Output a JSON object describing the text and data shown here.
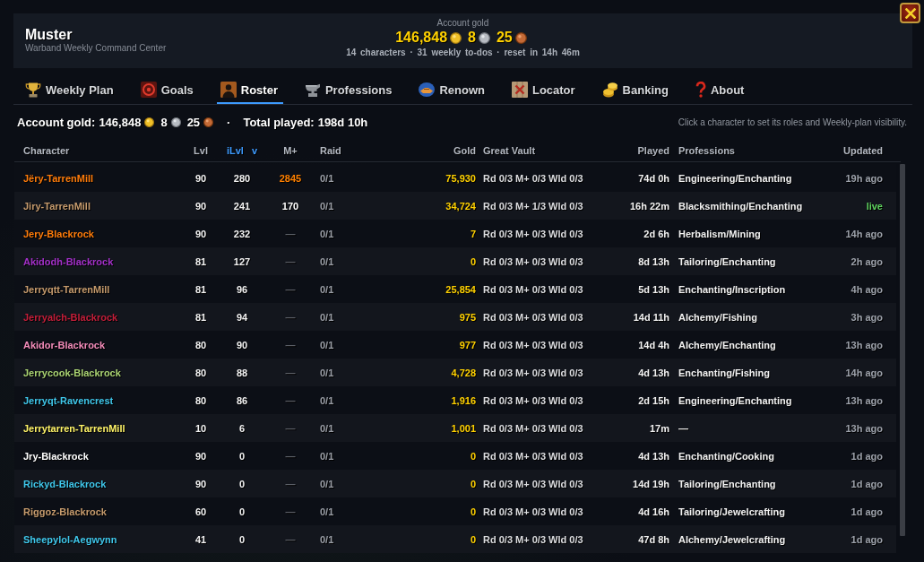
{
  "window": {
    "title": "Muster",
    "subtitle": "Warband Weekly Command Center"
  },
  "account_gold": {
    "label": "Account gold",
    "amounts": [
      {
        "kind": "gold",
        "value": "146,848"
      },
      {
        "kind": "silver",
        "value": "8"
      },
      {
        "kind": "copper",
        "value": "25"
      }
    ],
    "stats": "14 characters · 31 weekly to-dos · reset in 14h 46m"
  },
  "tabs": [
    {
      "label": "Weekly Plan",
      "selected": false
    },
    {
      "label": "Goals",
      "selected": false
    },
    {
      "label": "Roster",
      "selected": true
    },
    {
      "label": "Professions",
      "selected": false
    },
    {
      "label": "Renown",
      "selected": false
    },
    {
      "label": "Locator",
      "selected": false
    },
    {
      "label": "Banking",
      "selected": false
    },
    {
      "label": "About",
      "selected": false
    }
  ],
  "summary": {
    "gold_label": "Account gold:",
    "amounts": [
      {
        "kind": "gold",
        "value": "146,848"
      },
      {
        "kind": "silver",
        "value": "8"
      },
      {
        "kind": "copper",
        "value": "25"
      }
    ],
    "separator": "·",
    "played_label": "Total played:",
    "played": "198d 10h",
    "hint": "Click a character to set its roles and Weekly-plan visibility."
  },
  "table": {
    "columns": [
      {
        "label": "Character",
        "sorted": false
      },
      {
        "label": "Lvl",
        "sorted": false
      },
      {
        "label": "iLvl",
        "sorted": true,
        "sort_indicator": "v"
      },
      {
        "label": "M+",
        "sorted": false
      },
      {
        "label": "Raid",
        "sorted": false
      },
      {
        "label": "Gold",
        "sorted": false
      },
      {
        "label": "Great Vault",
        "sorted": false
      },
      {
        "label": "Played",
        "sorted": false
      },
      {
        "label": "Professions",
        "sorted": false
      },
      {
        "label": "Updated",
        "sorted": false
      }
    ],
    "rows": [
      {
        "name": "Jëry-TarrenMill",
        "color": "#ff7c0a",
        "level": "90",
        "ilvl": "280",
        "mplus": {
          "value": "2845",
          "color": "#ff8000"
        },
        "raid": "0/1",
        "gold": "75,930",
        "vault": "Rd 0/3 M+ 0/3 Wld 0/3",
        "played": "74d 0h",
        "professions": "Engineering/Enchanting",
        "updated": "19h ago",
        "live": false
      },
      {
        "name": "Jiry-TarrenMill",
        "color": "#c69b6d",
        "level": "90",
        "ilvl": "241",
        "mplus": {
          "value": "170",
          "color": "#ffffff"
        },
        "raid": "0/1",
        "gold": "34,724",
        "vault": "Rd 0/3 M+ 1/3 Wld 0/3",
        "played": "16h 22m",
        "professions": "Blacksmithing/Enchanting",
        "updated": "live",
        "live": true
      },
      {
        "name": "Jery-Blackrock",
        "color": "#ff7c0a",
        "level": "90",
        "ilvl": "232",
        "mplus": {
          "value": "—",
          "color": "#5f636b"
        },
        "raid": "0/1",
        "gold": "7",
        "vault": "Rd 0/3 M+ 0/3 Wld 0/3",
        "played": "2d 6h",
        "professions": "Herbalism/Mining",
        "updated": "14h ago",
        "live": false
      },
      {
        "name": "Akidodh-Blackrock",
        "color": "#a330c9",
        "level": "81",
        "ilvl": "127",
        "mplus": {
          "value": "—",
          "color": "#5f636b"
        },
        "raid": "0/1",
        "gold": "0",
        "vault": "Rd 0/3 M+ 0/3 Wld 0/3",
        "played": "8d 13h",
        "professions": "Tailoring/Enchanting",
        "updated": "2h ago",
        "live": false
      },
      {
        "name": "Jerryqtt-TarrenMill",
        "color": "#c69b6d",
        "level": "81",
        "ilvl": "96",
        "mplus": {
          "value": "—",
          "color": "#5f636b"
        },
        "raid": "0/1",
        "gold": "25,854",
        "vault": "Rd 0/3 M+ 0/3 Wld 0/3",
        "played": "5d 13h",
        "professions": "Enchanting/Inscription",
        "updated": "4h ago",
        "live": false
      },
      {
        "name": "Jerryalch-Blackrock",
        "color": "#c41e3a",
        "level": "81",
        "ilvl": "94",
        "mplus": {
          "value": "—",
          "color": "#5f636b"
        },
        "raid": "0/1",
        "gold": "975",
        "vault": "Rd 0/3 M+ 0/3 Wld 0/3",
        "played": "14d 11h",
        "professions": "Alchemy/Fishing",
        "updated": "3h ago",
        "live": false
      },
      {
        "name": "Akidor-Blackrock",
        "color": "#f48cba",
        "level": "80",
        "ilvl": "90",
        "mplus": {
          "value": "—",
          "color": "#5f636b"
        },
        "raid": "0/1",
        "gold": "977",
        "vault": "Rd 0/3 M+ 0/3 Wld 0/3",
        "played": "14d 4h",
        "professions": "Alchemy/Enchanting",
        "updated": "13h ago",
        "live": false
      },
      {
        "name": "Jerrycook-Blackrock",
        "color": "#aad372",
        "level": "80",
        "ilvl": "88",
        "mplus": {
          "value": "—",
          "color": "#5f636b"
        },
        "raid": "0/1",
        "gold": "4,728",
        "vault": "Rd 0/3 M+ 0/3 Wld 0/3",
        "played": "4d 13h",
        "professions": "Enchanting/Fishing",
        "updated": "14h ago",
        "live": false
      },
      {
        "name": "Jerryqt-Ravencrest",
        "color": "#3fc7eb",
        "level": "80",
        "ilvl": "86",
        "mplus": {
          "value": "—",
          "color": "#5f636b"
        },
        "raid": "0/1",
        "gold": "1,916",
        "vault": "Rd 0/3 M+ 0/3 Wld 0/3",
        "played": "2d 15h",
        "professions": "Engineering/Enchanting",
        "updated": "13h ago",
        "live": false
      },
      {
        "name": "Jerrytarren-TarrenMill",
        "color": "#fff468",
        "level": "10",
        "ilvl": "6",
        "mplus": {
          "value": "—",
          "color": "#5f636b"
        },
        "raid": "0/1",
        "gold": "1,001",
        "vault": "Rd 0/3 M+ 0/3 Wld 0/3",
        "played": "17m",
        "professions": "—",
        "updated": "13h ago",
        "live": false
      },
      {
        "name": "Jry-Blackrock",
        "color": "#ffffff",
        "level": "90",
        "ilvl": "0",
        "mplus": {
          "value": "—",
          "color": "#5f636b"
        },
        "raid": "0/1",
        "gold": "0",
        "vault": "Rd 0/3 M+ 0/3 Wld 0/3",
        "played": "4d 13h",
        "professions": "Enchanting/Cooking",
        "updated": "1d ago",
        "live": false
      },
      {
        "name": "Rickyd-Blackrock",
        "color": "#3fc7eb",
        "level": "90",
        "ilvl": "0",
        "mplus": {
          "value": "—",
          "color": "#5f636b"
        },
        "raid": "0/1",
        "gold": "0",
        "vault": "Rd 0/3 M+ 0/3 Wld 0/3",
        "played": "14d 19h",
        "professions": "Tailoring/Enchanting",
        "updated": "1d ago",
        "live": false
      },
      {
        "name": "Riggoz-Blackrock",
        "color": "#c69b6d",
        "level": "60",
        "ilvl": "0",
        "mplus": {
          "value": "—",
          "color": "#5f636b"
        },
        "raid": "0/1",
        "gold": "0",
        "vault": "Rd 0/3 M+ 0/3 Wld 0/3",
        "played": "4d 16h",
        "professions": "Tailoring/Jewelcrafting",
        "updated": "1d ago",
        "live": false
      },
      {
        "name": "Sheepylol-Aegwynn",
        "color": "#3fc7eb",
        "level": "41",
        "ilvl": "0",
        "mplus": {
          "value": "—",
          "color": "#5f636b"
        },
        "raid": "0/1",
        "gold": "0",
        "vault": "Rd 0/3 M+ 0/3 Wld 0/3",
        "played": "47d 8h",
        "professions": "Alchemy/Jewelcrafting",
        "updated": "1d ago",
        "live": false
      }
    ]
  }
}
